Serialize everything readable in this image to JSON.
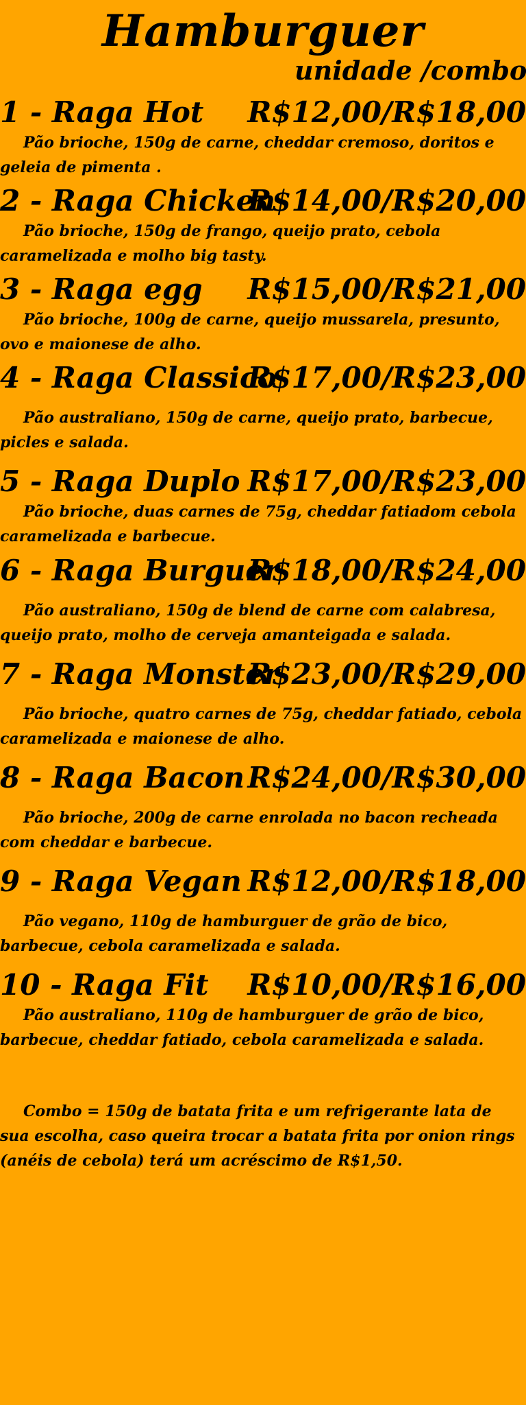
{
  "menu": {
    "title": "Hamburguer",
    "subtitle": "unidade /combo",
    "items": [
      {
        "name": "1 - Raga Hot",
        "price": "R$12,00/R$18,00",
        "description": "Pão brioche, 150g de carne, cheddar cremoso, doritos e geleia de pimenta ."
      },
      {
        "name": "2 - Raga Chicken",
        "price": "R$14,00/R$20,00",
        "description": "Pão brioche, 150g de frango, queijo prato, cebola caramelizada e molho big tasty."
      },
      {
        "name": "3 - Raga egg",
        "price": "R$15,00/R$21,00",
        "description": "Pão brioche, 100g de carne, queijo mussarela, presunto, ovo e maionese de alho."
      },
      {
        "name": "4 - Raga Classico",
        "price": "R$17,00/R$23,00",
        "description": "Pão australiano, 150g de carne, queijo prato, barbecue, picles e salada."
      },
      {
        "name": "5 - Raga Duplo",
        "price": "R$17,00/R$23,00",
        "description": "Pão brioche, duas carnes de 75g, cheddar fatiadom cebola caramelizada e barbecue."
      },
      {
        "name": "6 - Raga Burguer",
        "price": "R$18,00/R$24,00",
        "description": "Pão australiano, 150g de blend de carne com calabresa, queijo prato, molho de cerveja amanteigada e salada."
      },
      {
        "name": "7 - Raga Monster",
        "price": "R$23,00/R$29,00",
        "description": "Pão brioche, quatro carnes de 75g, cheddar fatiado, cebola caramelizada e maionese de alho."
      },
      {
        "name": "8 - Raga Bacon",
        "price": "R$24,00/R$30,00",
        "description": "Pão brioche, 200g de carne enrolada no bacon recheada com cheddar e barbecue."
      },
      {
        "name": "9 - Raga Vegan",
        "price": "R$12,00/R$18,00",
        "description": "Pão vegano, 110g de hamburguer de grão de bico, barbecue, cebola caramelizada e salada."
      },
      {
        "name": "10 - Raga Fit",
        "price": "R$10,00/R$16,00",
        "description": "Pão australiano, 110g de hamburguer de grão de bico, barbecue, cheddar fatiado, cebola caramelizada e salada."
      }
    ],
    "combo_note": "Combo = 150g de batata frita e um refrigerante lata de sua escolha, caso queira trocar a batata frita por onion rings (anéis de cebola) terá um acréscimo de R$1,50."
  },
  "colors": {
    "background": "#FFA500",
    "text": "#000000"
  }
}
